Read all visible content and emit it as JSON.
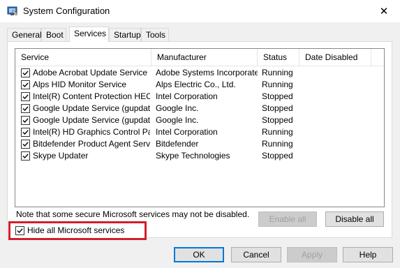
{
  "window": {
    "title": "System Configuration",
    "close_glyph": "✕"
  },
  "tabs": [
    {
      "label": "General"
    },
    {
      "label": "Boot"
    },
    {
      "label": "Services",
      "active": true
    },
    {
      "label": "Startup"
    },
    {
      "label": "Tools"
    }
  ],
  "columns": [
    "Service",
    "Manufacturer",
    "Status",
    "Date Disabled"
  ],
  "services": [
    {
      "checked": true,
      "service": "Adobe Acrobat Update Service",
      "manufacturer": "Adobe Systems Incorporated",
      "status": "Running",
      "date_disabled": ""
    },
    {
      "checked": true,
      "service": "Alps HID Monitor Service",
      "manufacturer": "Alps Electric Co., Ltd.",
      "status": "Running",
      "date_disabled": ""
    },
    {
      "checked": true,
      "service": "Intel(R) Content Protection HEC...",
      "manufacturer": "Intel Corporation",
      "status": "Stopped",
      "date_disabled": ""
    },
    {
      "checked": true,
      "service": "Google Update Service (gupdate)",
      "manufacturer": "Google Inc.",
      "status": "Stopped",
      "date_disabled": ""
    },
    {
      "checked": true,
      "service": "Google Update Service (gupdatem)",
      "manufacturer": "Google Inc.",
      "status": "Stopped",
      "date_disabled": ""
    },
    {
      "checked": true,
      "service": "Intel(R) HD Graphics Control Pa...",
      "manufacturer": "Intel Corporation",
      "status": "Running",
      "date_disabled": ""
    },
    {
      "checked": true,
      "service": "Bitdefender Product Agent Service",
      "manufacturer": "Bitdefender",
      "status": "Running",
      "date_disabled": ""
    },
    {
      "checked": true,
      "service": "Skype Updater",
      "manufacturer": "Skype Technologies",
      "status": "Stopped",
      "date_disabled": ""
    }
  ],
  "note": "Note that some secure Microsoft services may not be disabled.",
  "buttons": {
    "enable_all": "Enable all",
    "disable_all": "Disable all",
    "ok": "OK",
    "cancel": "Cancel",
    "apply": "Apply",
    "help": "Help"
  },
  "hide_ms": {
    "label": "Hide all Microsoft services",
    "checked": true
  },
  "colors": {
    "highlight_border": "#d21f2d",
    "default_button_border": "#0078d7"
  }
}
